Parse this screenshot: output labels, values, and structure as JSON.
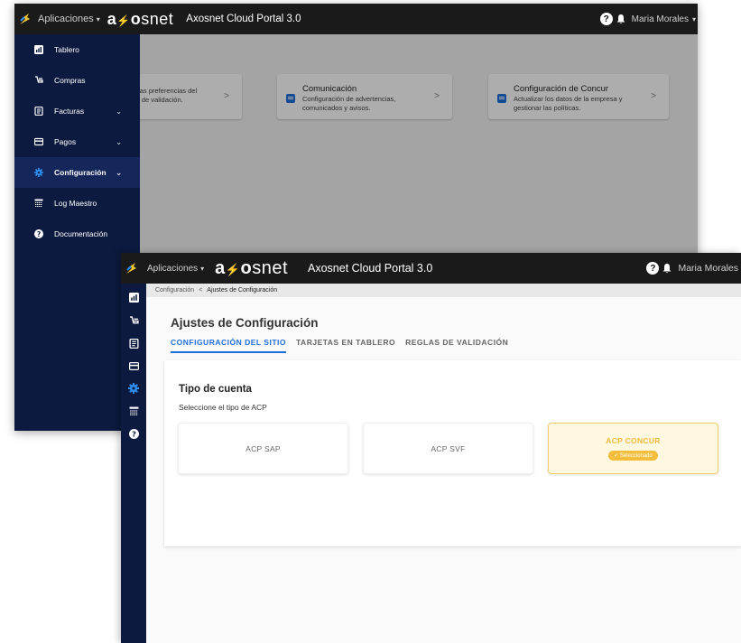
{
  "header": {
    "apps_label": "Aplicaciones",
    "brand": [
      "a",
      "⚡",
      "o",
      "snet"
    ],
    "portal_title": "Axosnet Cloud Portal 3.0",
    "help_glyph": "?",
    "user_name": "Maria Morales"
  },
  "background_cards": [
    {
      "title": "",
      "line1": "sta las preferencias del",
      "line2": "glas de validación."
    },
    {
      "title": "Comunicación",
      "line1": "Configuración de advertencias,",
      "line2": "comunicados y avisos."
    },
    {
      "title": "Configuración de Concur",
      "line1": "Actualizar los datos de la empresa y",
      "line2": "gestionar las políticas."
    }
  ],
  "sidebar": {
    "items": [
      {
        "label": "Tablero",
        "icon": "dashboard-icon"
      },
      {
        "label": "Compras",
        "icon": "cart-icon"
      },
      {
        "label": "Facturas",
        "icon": "invoice-icon",
        "expandable": true
      },
      {
        "label": "Pagos",
        "icon": "card-icon",
        "expandable": true
      },
      {
        "label": "Configuración",
        "icon": "gear-icon",
        "expandable": true,
        "active": true
      },
      {
        "label": "Log Maestro",
        "icon": "log-icon"
      },
      {
        "label": "Documentación",
        "icon": "help-icon"
      }
    ]
  },
  "breadcrumb": {
    "parent": "Configuración",
    "separator": "<",
    "current": "Ajustes de Configuración"
  },
  "page": {
    "title": "Ajustes de Configuración",
    "tabs": [
      {
        "label": "CONFIGURACIÓN DEL SITIO",
        "active": true
      },
      {
        "label": "TARJETAS EN TABLERO",
        "active": false
      },
      {
        "label": "REGLAS DE VALIDACIÓN",
        "active": false
      }
    ],
    "section_title": "Tipo de cuenta",
    "section_subtitle": "Seleccione el tipo de ACP",
    "options": [
      {
        "label": "ACP SAP",
        "selected": false
      },
      {
        "label": "ACP SVF",
        "selected": false
      },
      {
        "label": "ACP CONCUR",
        "selected": true,
        "badge": "✓ Seleccionado"
      }
    ]
  },
  "colors": {
    "topbar": "#1a1a1a",
    "sidebar": "#0c1a3f",
    "accent": "#1e6fd9",
    "selected": "#f4bd3c"
  }
}
